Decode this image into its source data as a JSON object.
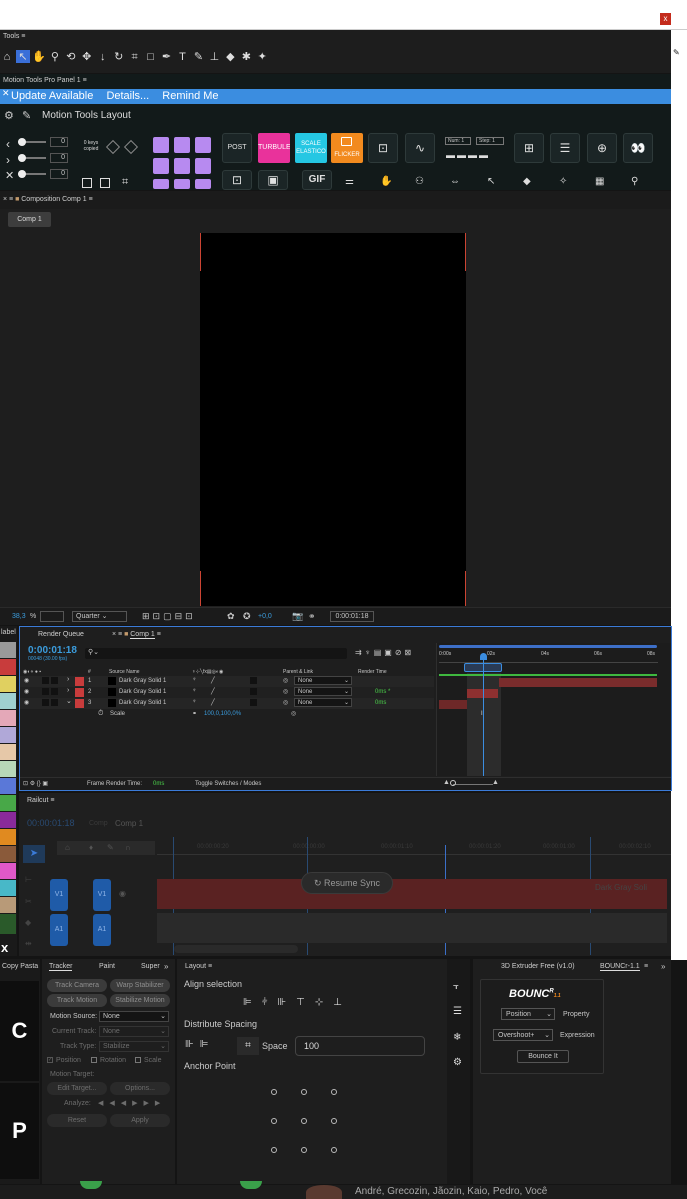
{
  "window": {
    "close_label": "x"
  },
  "tools": {
    "title": "Tools",
    "menu": "≡"
  },
  "motion_tools": {
    "tab_title": "Motion Tools Pro Panel 1",
    "update_banner": {
      "message": "Update Available",
      "details": "Details...",
      "remind": "Remind Me"
    },
    "layout_title": "Motion Tools Layout",
    "keys_label": "0 keys copied",
    "num_values": [
      "0",
      "0",
      "0"
    ],
    "post_label": "POST",
    "turbulent_label": "TURBULENT",
    "scale_label": "SCALE ELASTICO",
    "flicker_label": "FLICKER",
    "num_label": "Num: 1",
    "step_label": "Step: 1",
    "gif_label": "GIF",
    "colors": {
      "turbulent": "#e9329b",
      "scale": "#25c7e3",
      "flicker": "#f28a1e",
      "purple": "#b78af0"
    }
  },
  "composition": {
    "tab_title": "Composition Comp 1",
    "comp_chip": "Comp 1",
    "zoom": "38,3",
    "zoom_unit": "%",
    "resolution": "Quarter",
    "exposure": "+0,0",
    "timecode": "0:00:01:18"
  },
  "timeline": {
    "label_panel": "label",
    "render_queue_tab": "Render Queue",
    "comp_tab": "Comp 1",
    "current_time": "0:00:01:18",
    "fps": "00048 (30.00 fps)",
    "search_placeholder": "",
    "columns": {
      "num": "#",
      "source": "Source Name",
      "parent": "Parent & Link",
      "render": "Render Time"
    },
    "layers": [
      {
        "num": "1",
        "name": "Dark Gray Solid 1",
        "parent": "None",
        "render": ""
      },
      {
        "num": "2",
        "name": "Dark Gray Solid 1",
        "parent": "None",
        "render": "0ms *"
      },
      {
        "num": "3",
        "name": "Dark Gray Solid 1",
        "parent": "None",
        "render": "0ms"
      }
    ],
    "scale_prop": {
      "name": "Scale",
      "value": "100,0,100,0%"
    },
    "ruler": [
      "0:00s",
      "02s",
      "04s",
      "06s",
      "08s"
    ],
    "frame_render_label": "Frame Render Time:",
    "frame_render_value": "0ms",
    "toggle_label": "Toggle Switches / Modes"
  },
  "railcut": {
    "title": "Railcut",
    "timecode": "00:00:01:18",
    "comp_label": "Comp",
    "comp_name": "Comp 1",
    "ruler": [
      "00:00:00:20",
      "00:00:00:00",
      "00:00:01:10",
      "00:00:01:20",
      "00:00:01:00",
      "00:00:02:10"
    ],
    "resume_sync": "Resume Sync",
    "track_v1": "V1",
    "track_a1": "A1",
    "clip_label": "Dark Gray Soli",
    "x_label": "x"
  },
  "copy_paste": {
    "title": "Copy Pasta",
    "c_label": "C",
    "p_label": "P"
  },
  "tracker": {
    "tabs": [
      "Tracker",
      "Paint",
      "Super"
    ],
    "track_camera": "Track Camera",
    "warp_stabilizer": "Warp Stabilizer",
    "track_motion": "Track Motion",
    "stabilize_motion": "Stabilize Motion",
    "motion_source_label": "Motion Source:",
    "motion_source_value": "None",
    "current_track_label": "Current Track:",
    "current_track_value": "None",
    "track_type_label": "Track Type:",
    "track_type_value": "Stabilize",
    "position": "Position",
    "rotation": "Rotation",
    "scale": "Scale",
    "motion_target": "Motion Target:",
    "edit_target": "Edit Target...",
    "options": "Options...",
    "analyze": "Analyze:",
    "reset": "Reset",
    "apply": "Apply"
  },
  "layout_panel": {
    "title": "Layout",
    "align_selection": "Align selection",
    "distribute_spacing": "Distribute Spacing",
    "space_label": "Space",
    "space_value": "100",
    "anchor_point": "Anchor Point"
  },
  "bouncr": {
    "extruder_tab": "3D Extruder Free (v1.0)",
    "bouncr_tab": "BOUNCr-1.1",
    "logo": "BOUNC",
    "logo_sup": "R",
    "logo_version": "1.1",
    "position_select": "Position",
    "property_label": "Property",
    "overshoot_select": "Overshoot+",
    "expression_label": "Expression",
    "bounce_button": "Bounce It"
  },
  "footer": {
    "names": "André, Grecozin, Jãozin, Kaio, Pedro, Você"
  }
}
